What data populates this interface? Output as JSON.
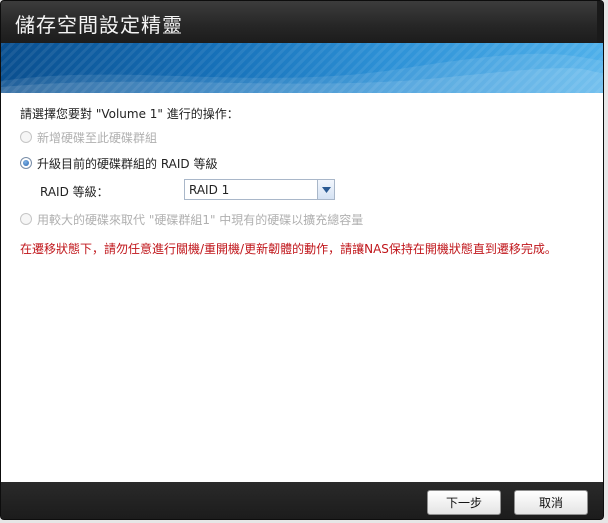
{
  "dialog": {
    "title": "儲存空間設定精靈"
  },
  "content": {
    "prompt": "請選擇您要對 \"Volume 1\" 進行的操作：",
    "options": [
      {
        "label": "新增硬碟至此硬碟群組",
        "enabled": false,
        "selected": false
      },
      {
        "label": "升級目前的硬碟群組的 RAID 等級",
        "enabled": true,
        "selected": true
      },
      {
        "label": "用較大的硬碟來取代 \"硬碟群組1\" 中現有的硬碟以擴充總容量",
        "enabled": false,
        "selected": false
      }
    ],
    "raid_level": {
      "label": "RAID 等級：",
      "selected": "RAID 1"
    },
    "warning": "在遷移狀態下，請勿任意進行關機/重開機/更新韌體的動作，請讓NAS保持在開機狀態直到遷移完成。"
  },
  "footer": {
    "next_label": "下一步",
    "cancel_label": "取消"
  },
  "colors": {
    "warning": "#c0161b",
    "banner": "#1670b8",
    "titlebar": "#262626"
  }
}
